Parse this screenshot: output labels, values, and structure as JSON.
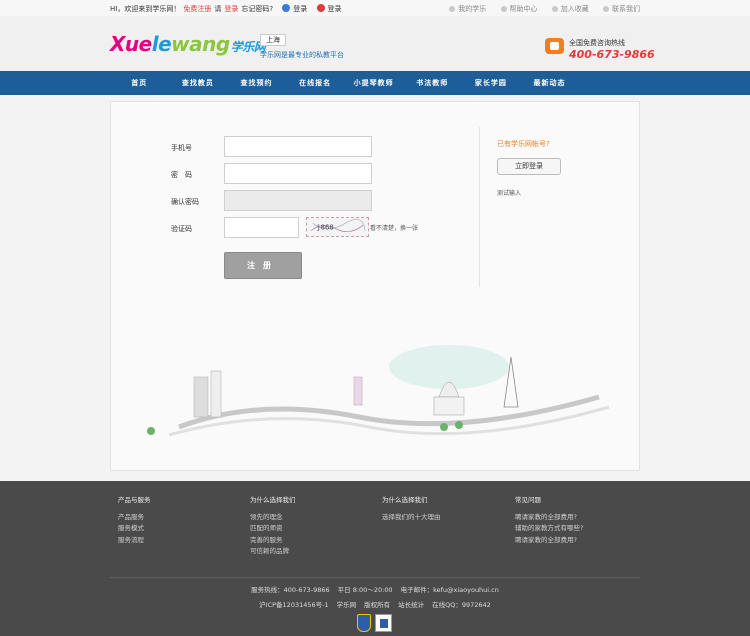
{
  "topbar": {
    "welcome": "HI，欢迎来到学乐网！",
    "register": "免费注册",
    "please": "请",
    "login": "登录",
    "forgot": "忘记密码?",
    "qq_login": "登录",
    "weibo_login": "登录",
    "my_xuele": "我的学乐",
    "help": "帮助中心",
    "favorite": "加入收藏",
    "contact": "联系我们"
  },
  "header": {
    "logo_xue": "Xue",
    "logo_le": "le",
    "logo_wang": "wang",
    "logo_cn": "学乐网",
    "city": "上海",
    "slogan": "学乐网是最专业的私教平台",
    "hotline_label": "全国免费咨询热线",
    "hotline_number": "400-673-9866"
  },
  "nav": {
    "items": [
      "首页",
      "查找教员",
      "查找预约",
      "在线报名",
      "小提琴教师",
      "书法教师",
      "家长学园",
      "最新动态"
    ]
  },
  "form": {
    "phone_label": "手机号",
    "password_label": "密　码",
    "confirm_label": "确认密码",
    "captcha_label": "验证码",
    "captcha_tip": "看不清楚，换一张",
    "submit": "注册"
  },
  "side": {
    "has_account": "已有学乐网帐号?",
    "login_now": "立即登录",
    "test_input": "测试输入"
  },
  "footer": {
    "col1": {
      "title": "产品与服务",
      "items": [
        "产品服务",
        "服务模式",
        "服务流程"
      ]
    },
    "col2": {
      "title": "为什么选择我们",
      "items": [
        "领先的理念",
        "匹配的师资",
        "完善的服务",
        "可信赖的品牌"
      ]
    },
    "col3": {
      "title": "为什么选择我们",
      "items": [
        "选择我们的十大理由"
      ]
    },
    "col4": {
      "title": "常见问题",
      "items": [
        "聘请家教的全部费用?",
        "辅助的家教方式有哪些?",
        "聘请家教的全部费用?"
      ]
    },
    "service_line": "服务热线：400-673-9866",
    "work_hours": "平日 8:00～20:00",
    "email": "电子邮件：kefu@xiaoyouhui.cn",
    "icp": "沪ICP备12031456号-1",
    "site": "学乐网",
    "copyright": "版权所有",
    "stats": "站长统计",
    "qq": "在线QQ：9972642"
  }
}
